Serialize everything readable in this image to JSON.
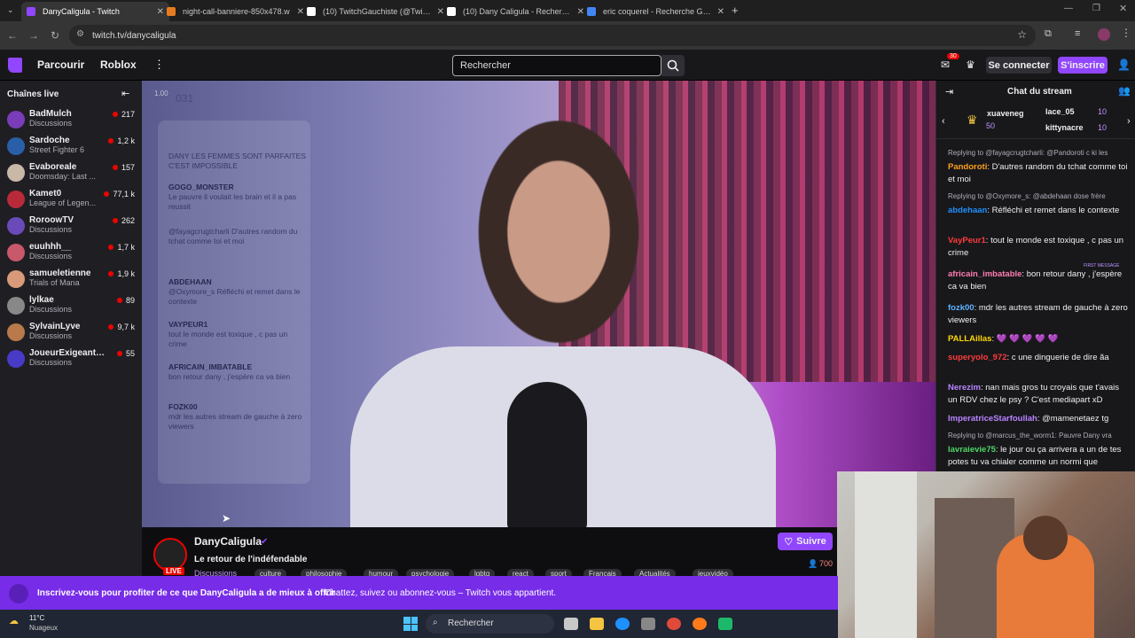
{
  "browser": {
    "tabs": [
      {
        "title": "DanyCaligula - Twitch",
        "color": "#9146ff"
      },
      {
        "title": "night-call-banniere-850x478.w",
        "color": "#e57c1f"
      },
      {
        "title": "(10) TwitchGauchiste (@Twitch",
        "color": "#ffffff"
      },
      {
        "title": "(10) Dany Caligula - Recherche",
        "color": "#ffffff"
      },
      {
        "title": "eric coquerel - Recherche Goog",
        "color": "#4285f4"
      }
    ],
    "url": "twitch.tv/danycaligula"
  },
  "nav": {
    "browse": "Parcourir",
    "game": "Roblox",
    "search_placeholder": "Rechercher",
    "notif_count": "30",
    "login": "Se connecter",
    "signup": "S'inscrire"
  },
  "sidebar": {
    "title": "Chaînes live",
    "channels": [
      {
        "name": "BadMulch",
        "game": "Discussions",
        "viewers": "217",
        "color": "#7a3cb8"
      },
      {
        "name": "Sardoche",
        "game": "Street Fighter 6",
        "viewers": "1,2 k",
        "color": "#2a5ea8"
      },
      {
        "name": "Evaboreale",
        "game": "Doomsday: Last ...",
        "viewers": "157",
        "color": "#c9b8a8"
      },
      {
        "name": "Kamet0",
        "game": "League of Legen...",
        "viewers": "77,1 k",
        "color": "#b82a3a"
      },
      {
        "name": "RoroowTV",
        "game": "Discussions",
        "viewers": "262",
        "color": "#6a4ab8"
      },
      {
        "name": "euuhhh__",
        "game": "Discussions",
        "viewers": "1,7 k",
        "color": "#c8586a"
      },
      {
        "name": "samueletienne",
        "game": "Trials of Mana",
        "viewers": "1,9 k",
        "color": "#d89a78"
      },
      {
        "name": "lylkae",
        "game": "Discussions",
        "viewers": "89",
        "color": "#888888"
      },
      {
        "name": "SylvainLyve",
        "game": "Discussions",
        "viewers": "9,7 k",
        "color": "#b87a4a"
      },
      {
        "name": "JoueurExigeantLi...",
        "game": "Discussions",
        "viewers": "55",
        "color": "#4a3ac8"
      }
    ]
  },
  "video": {
    "overlay_time": "1.00",
    "overlay_count": "031",
    "overlay": [
      {
        "user": "",
        "text": "DANY LES FEMMES SONT PARFAITES C'EST IMPOSSIBLE"
      },
      {
        "user": "GOGO_MONSTER",
        "text": "Le pauvre il voulait les brain et il a pas reussit"
      },
      {
        "user": "",
        "text": "@fayagcrugtcharli D'autres random du tchat comme toi et moi"
      },
      {
        "user": "ABDEHAAN",
        "text": "@Oxymore_s Réfléchi et remet dans le contexte"
      },
      {
        "user": "VAYPEUR1",
        "text": "tout le monde est toxique , c pas un crime"
      },
      {
        "user": "AFRICAIN_IMBATABLE",
        "text": "bon retour dany , j'espère ca va bien"
      },
      {
        "user": "FOZK00",
        "text": "mdr les autres stream de gauche à zero viewers"
      }
    ]
  },
  "channel": {
    "name": "DanyCaligula",
    "title": "Le retour de l'indéfendable",
    "live": "LIVE",
    "category": "Discussions",
    "tags": [
      "culture",
      "philosophie",
      "humour",
      "psychologie",
      "lgbtq",
      "react",
      "sport",
      "Français",
      "Actualités",
      "jeuxvidéo"
    ],
    "follow": "Suivre",
    "viewers": "700"
  },
  "chat": {
    "title": "Chat du stream",
    "gifts": [
      {
        "name": "xuaveneg",
        "count": "50"
      },
      {
        "name": "lace_05",
        "count": "10"
      },
      {
        "name": "kittynacre",
        "count": "10"
      }
    ],
    "first_message_badge": "FIRST MESSAGE",
    "messages": [
      {
        "reply": "Replying to @fayagcrugtcharli: @Pandoroti c ki les",
        "user": "Pandoroti",
        "color": "#ff9f1a",
        "text": "D'autres random du tchat comme toi et moi"
      },
      {
        "reply": "Replying to @Oxymore_s: @abdehaan dose frère",
        "user": "abdehaan",
        "color": "#1e90ff",
        "text": "Réfléchi et remet dans le contexte"
      },
      {
        "reply": "",
        "user": "VayPeur1",
        "color": "#ff3a3a",
        "text": "tout le monde est toxique , c pas un crime"
      },
      {
        "reply": "",
        "user": "africain_imbatable",
        "color": "#ff7eb3",
        "text": "bon retour dany , j'espère ca va bien"
      },
      {
        "reply": "",
        "user": "fozk00",
        "color": "#5fb3ff",
        "text": "mdr les autres stream de gauche à zero viewers"
      },
      {
        "reply": "",
        "user": "PALLAillas",
        "color": "#ffd700",
        "text": "💜 💜 💜 💜 💜"
      },
      {
        "reply": "",
        "user": "superyolo_972",
        "color": "#ff3a3a",
        "text": "c une dinguerie de dire ãa"
      },
      {
        "reply": "",
        "user": "Nerezim",
        "color": "#b983ff",
        "text": "nan mais gros tu croyais que t'avais un RDV chez le psy ? C'est mediapart xD"
      },
      {
        "reply": "",
        "user": "ImperatriceStarfoullah",
        "color": "#b983ff",
        "text": "@mamenetaez tg"
      },
      {
        "reply": "Replying to @marcus_the_worm1: Pauvre Dany vra",
        "user": "lavraievie75",
        "color": "#4cd964",
        "text": "le jour ou ça arrivera a un de tes potes tu va chialer comme un normi que"
      }
    ]
  },
  "banner": {
    "text": "Inscrivez-vous pour profiter de ce que DanyCaligula a de mieux à offrir",
    "subtext": "Chattez, suivez ou abonnez-vous – Twitch vous appartient."
  },
  "taskbar": {
    "temp": "11°C",
    "weather": "Nuageux",
    "search": "Rechercher"
  }
}
